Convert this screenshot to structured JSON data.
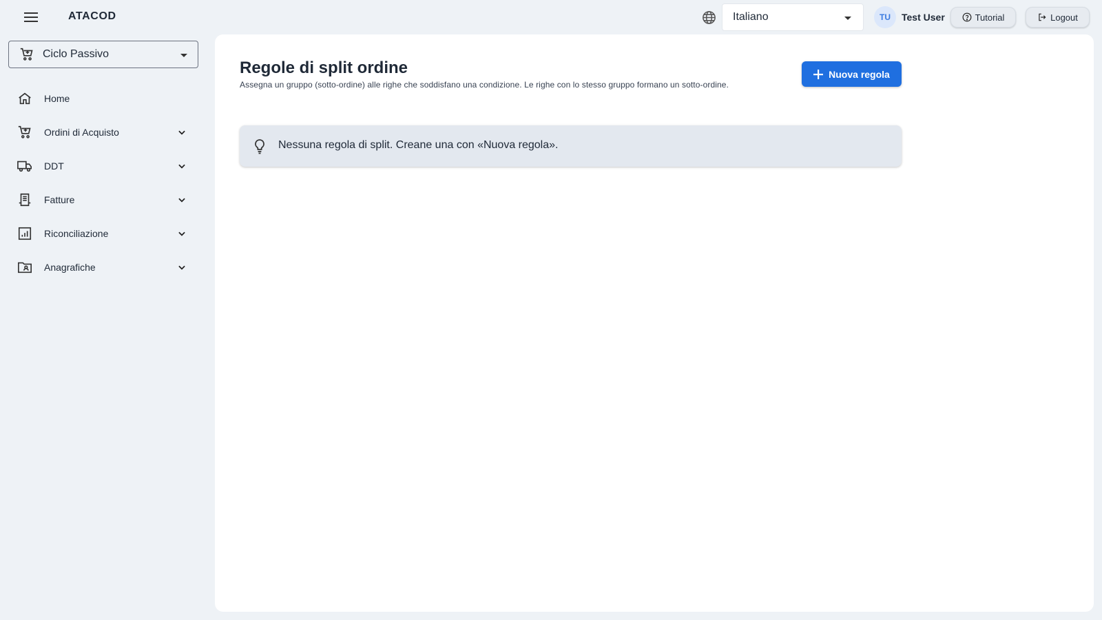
{
  "header": {
    "brand": "ATACOD",
    "language": "Italiano",
    "user_initials": "TU",
    "user_name": "Test User",
    "tutorial_label": "Tutorial",
    "logout_label": "Logout"
  },
  "sidebar": {
    "cycle": "Ciclo Passivo",
    "items": [
      {
        "label": "Home",
        "icon": "home-icon",
        "expandable": false
      },
      {
        "label": "Ordini di Acquisto",
        "icon": "cart-icon",
        "expandable": true
      },
      {
        "label": "DDT",
        "icon": "truck-icon",
        "expandable": true
      },
      {
        "label": "Fatture",
        "icon": "receipt-icon",
        "expandable": true
      },
      {
        "label": "Riconciliazione",
        "icon": "chart-icon",
        "expandable": true
      },
      {
        "label": "Anagrafiche",
        "icon": "folder-user-icon",
        "expandable": true
      }
    ]
  },
  "main": {
    "title": "Regole di split ordine",
    "subtitle": "Assegna un gruppo (sotto-ordine) alle righe che soddisfano una condizione. Le righe con lo stesso gruppo formano un sotto-ordine.",
    "new_rule_label": "Nuova regola",
    "empty_message": "Nessuna regola di split. Creane una con «Nuova regola»."
  },
  "colors": {
    "accent": "#1f6fe0",
    "background": "#eef2f6",
    "info_box": "#e3e8ef"
  }
}
